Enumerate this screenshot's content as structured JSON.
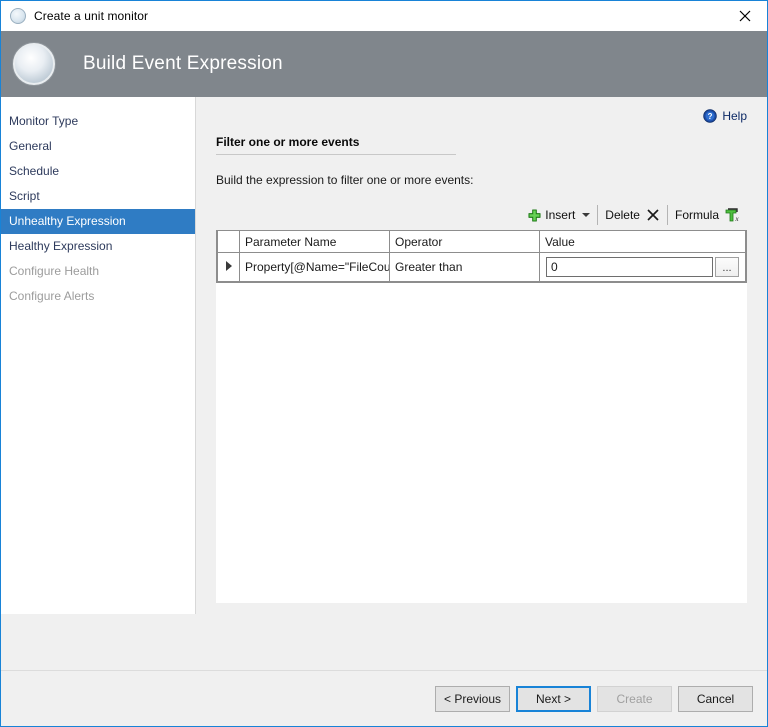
{
  "window": {
    "title": "Create a unit monitor",
    "title_icon": "circle-icon",
    "close_icon": "close-icon",
    "banner_title": "Build Event Expression",
    "banner_icon": "monitor-sphere-icon",
    "banner_color": "#80868c",
    "accent_color": "#1883d7"
  },
  "sidebar": {
    "items": [
      {
        "label": "Monitor Type",
        "state": "enabled"
      },
      {
        "label": "General",
        "state": "enabled"
      },
      {
        "label": "Schedule",
        "state": "enabled"
      },
      {
        "label": "Script",
        "state": "enabled"
      },
      {
        "label": "Unhealthy Expression",
        "state": "selected"
      },
      {
        "label": "Healthy Expression",
        "state": "enabled"
      },
      {
        "label": "Configure Health",
        "state": "disabled"
      },
      {
        "label": "Configure Alerts",
        "state": "disabled"
      }
    ],
    "selected_color": "#2f7cc4"
  },
  "content": {
    "help": {
      "label": "Help",
      "icon": "help-circle-icon"
    },
    "section_title": "Filter one or more events",
    "instruction": "Build the expression to filter one or more events:",
    "toolbar": {
      "insert_label": "Insert",
      "insert_icon": "green-plus-icon",
      "insert_caret": "chevron-down-icon",
      "delete_label": "Delete",
      "delete_icon": "x-mark-icon",
      "formula_label": "Formula",
      "formula_icon": "formula-fx-icon"
    },
    "grid": {
      "columns": [
        "",
        "Parameter Name",
        "Operator",
        "Value"
      ],
      "rows": [
        {
          "selector": "row-selector-arrow",
          "parameter_name": "Property[@Name=\"FileCoun...",
          "operator": "Greater than",
          "value": "0",
          "value_browse_label": "..."
        }
      ]
    }
  },
  "footer": {
    "buttons": [
      {
        "label": "< Previous",
        "state": "enabled"
      },
      {
        "label": "Next >",
        "state": "default"
      },
      {
        "label": "Create",
        "state": "disabled"
      },
      {
        "label": "Cancel",
        "state": "enabled"
      }
    ]
  }
}
